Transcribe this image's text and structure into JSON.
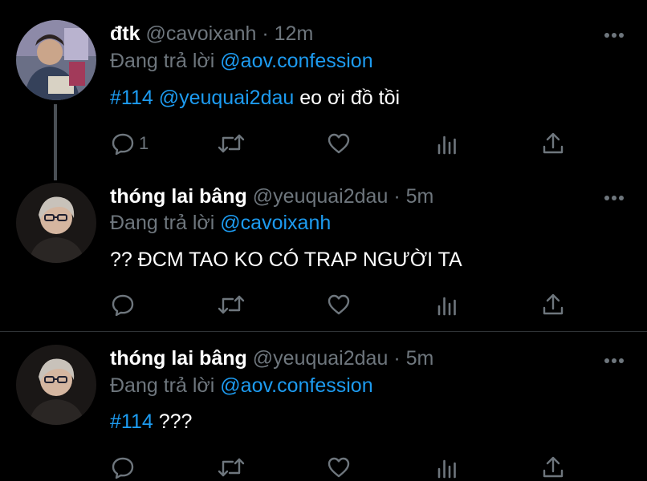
{
  "colors": {
    "background": "#000000",
    "secondary_text": "#6e767d",
    "link": "#1d9bf0",
    "divider": "#2f3336"
  },
  "tweets": [
    {
      "name": "đtk",
      "handle": "@cavoixanh",
      "separator": "·",
      "time": "12m",
      "reply_prefix": "Đang trả lời",
      "reply_to": "@aov.confession",
      "hashtag": "#114",
      "mention": "@yeuquai2dau",
      "text": "eo ơi đồ tồi",
      "reply_count": "1",
      "avatar_icon": "user-avatar"
    },
    {
      "name": "thóng lai bâng",
      "handle": "@yeuquai2dau",
      "separator": "·",
      "time": "5m",
      "reply_prefix": "Đang trả lời",
      "reply_to": "@cavoixanh",
      "text": "?? ĐCM TAO KO CÓ TRAP NGƯỜI TA",
      "reply_count": "",
      "avatar_icon": "user-avatar"
    },
    {
      "name": "thóng lai bâng",
      "handle": "@yeuquai2dau",
      "separator": "·",
      "time": "5m",
      "reply_prefix": "Đang trả lời",
      "reply_to": "@aov.confession",
      "hashtag": "#114",
      "text": "???",
      "reply_count": "",
      "avatar_icon": "user-avatar"
    }
  ],
  "action_icons": [
    "reply-icon",
    "retweet-icon",
    "like-icon",
    "analytics-icon",
    "share-icon"
  ]
}
